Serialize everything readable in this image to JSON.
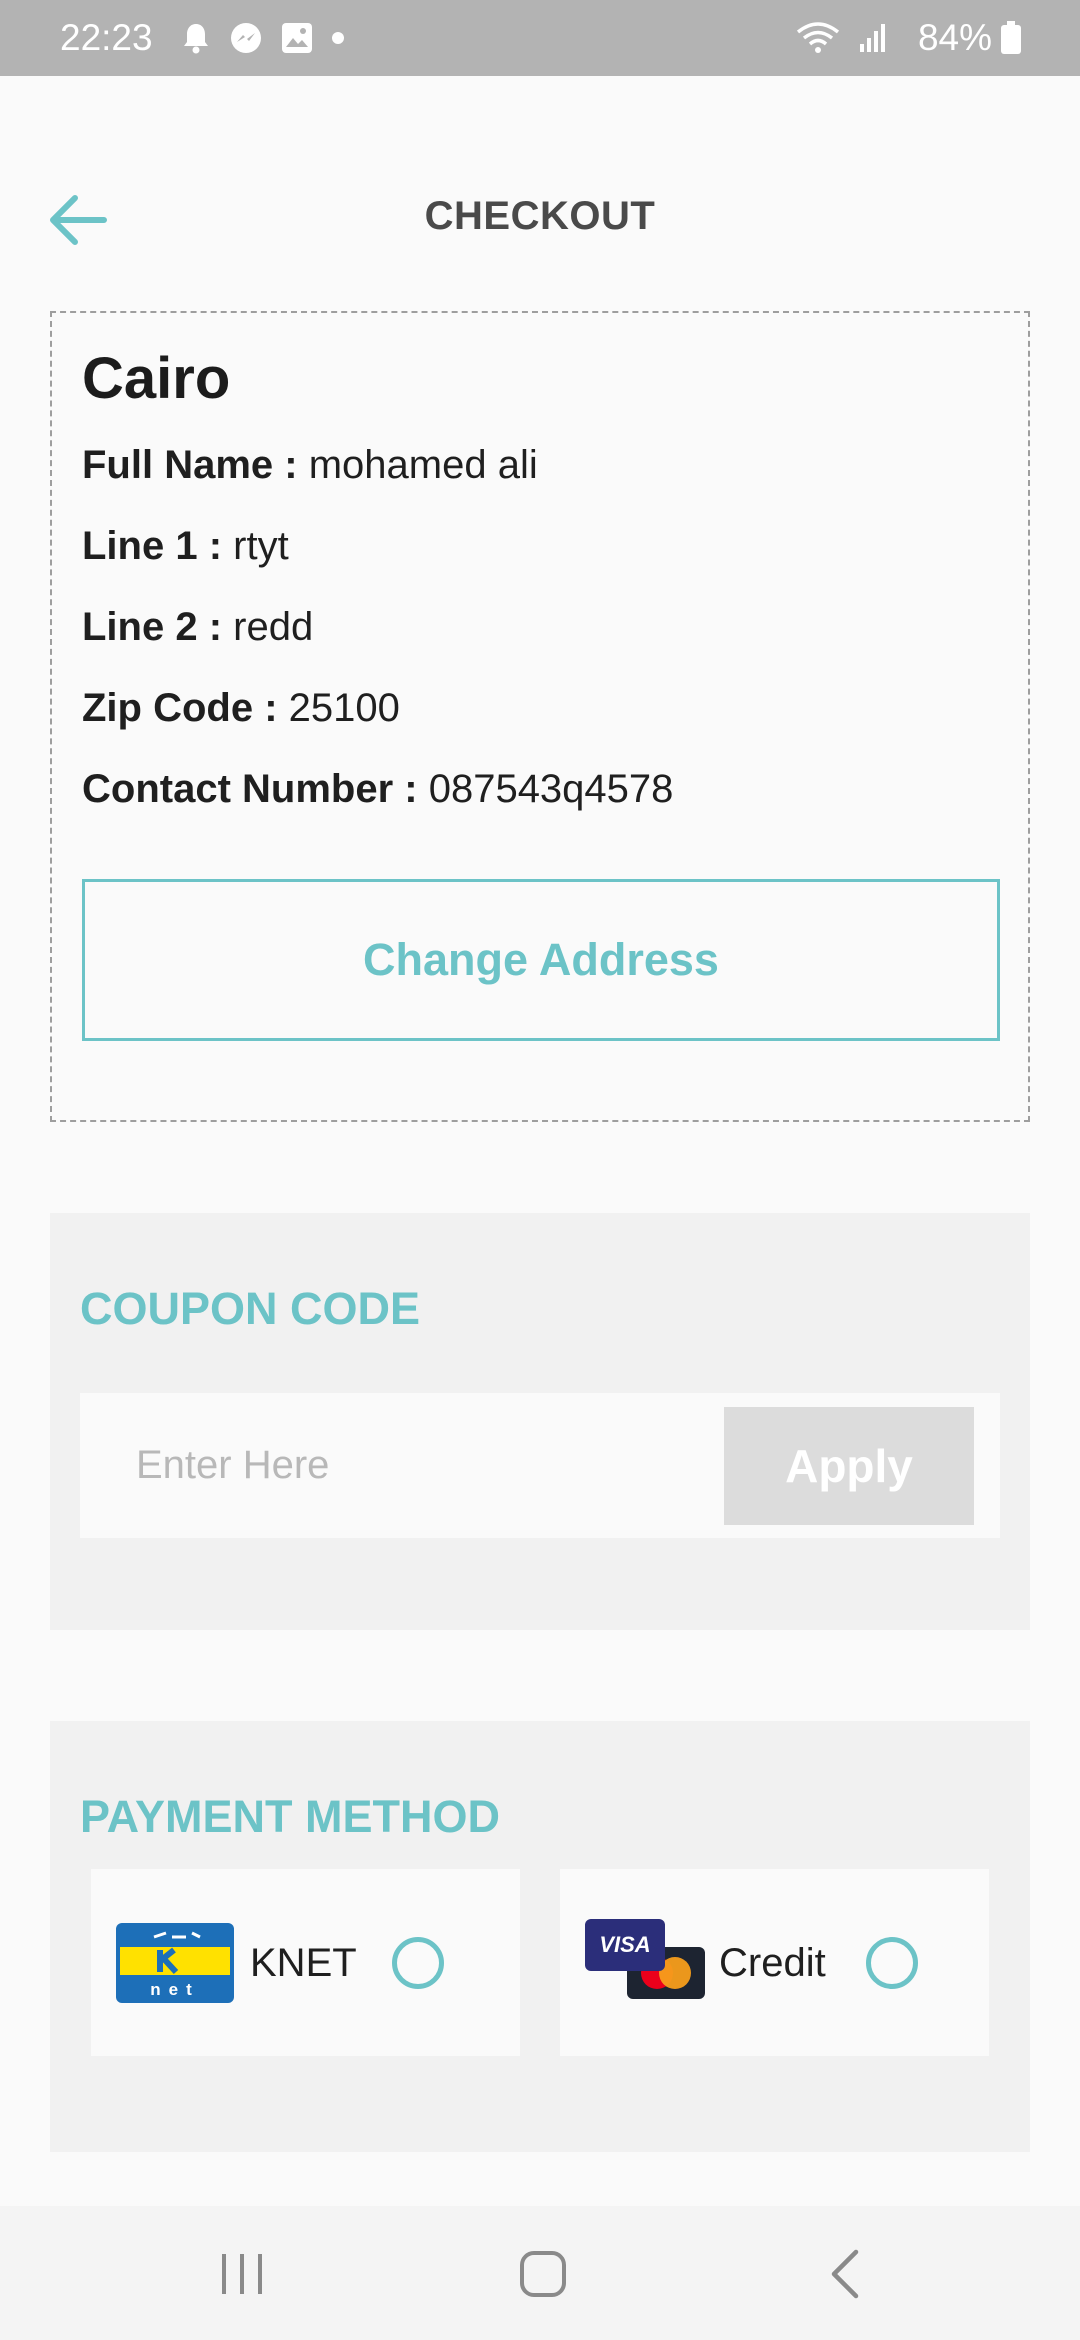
{
  "status_bar": {
    "time": "22:23",
    "battery": "84%",
    "icons": [
      "bell-icon",
      "messenger-icon",
      "gallery-icon",
      "dot-icon",
      "wifi-icon",
      "signal-icon",
      "battery-icon"
    ]
  },
  "header": {
    "title": "CHECKOUT",
    "back_icon": "arrow-left-icon"
  },
  "address": {
    "city": "Cairo",
    "fields": [
      {
        "label": "Full Name :",
        "value": "mohamed ali"
      },
      {
        "label": "Line 1 :",
        "value": "rtyt"
      },
      {
        "label": "Line 2 :",
        "value": "redd"
      },
      {
        "label": "Zip Code :",
        "value": "25100"
      },
      {
        "label": "Contact Number :",
        "value": "087543q4578"
      }
    ],
    "change_button": "Change Address"
  },
  "coupon": {
    "title": "COUPON CODE",
    "placeholder": "Enter Here",
    "value": "",
    "apply_button": "Apply"
  },
  "payment": {
    "title": "PAYMENT METHOD",
    "options": [
      {
        "label": "KNET",
        "logo": "knet-logo",
        "logo_text": "net",
        "selected": false
      },
      {
        "label": "Credit",
        "logo": "visa-mastercard-logo",
        "logo_text": "VISA",
        "selected": false
      }
    ]
  },
  "nav_bar": {
    "buttons": [
      "recent-apps-icon",
      "home-icon",
      "back-icon"
    ]
  },
  "colors": {
    "accent": "#6cc3c7",
    "status_bar": "#b3b3b3",
    "section_bg": "#f1f1f1",
    "apply_bg": "#dcdcdc"
  }
}
